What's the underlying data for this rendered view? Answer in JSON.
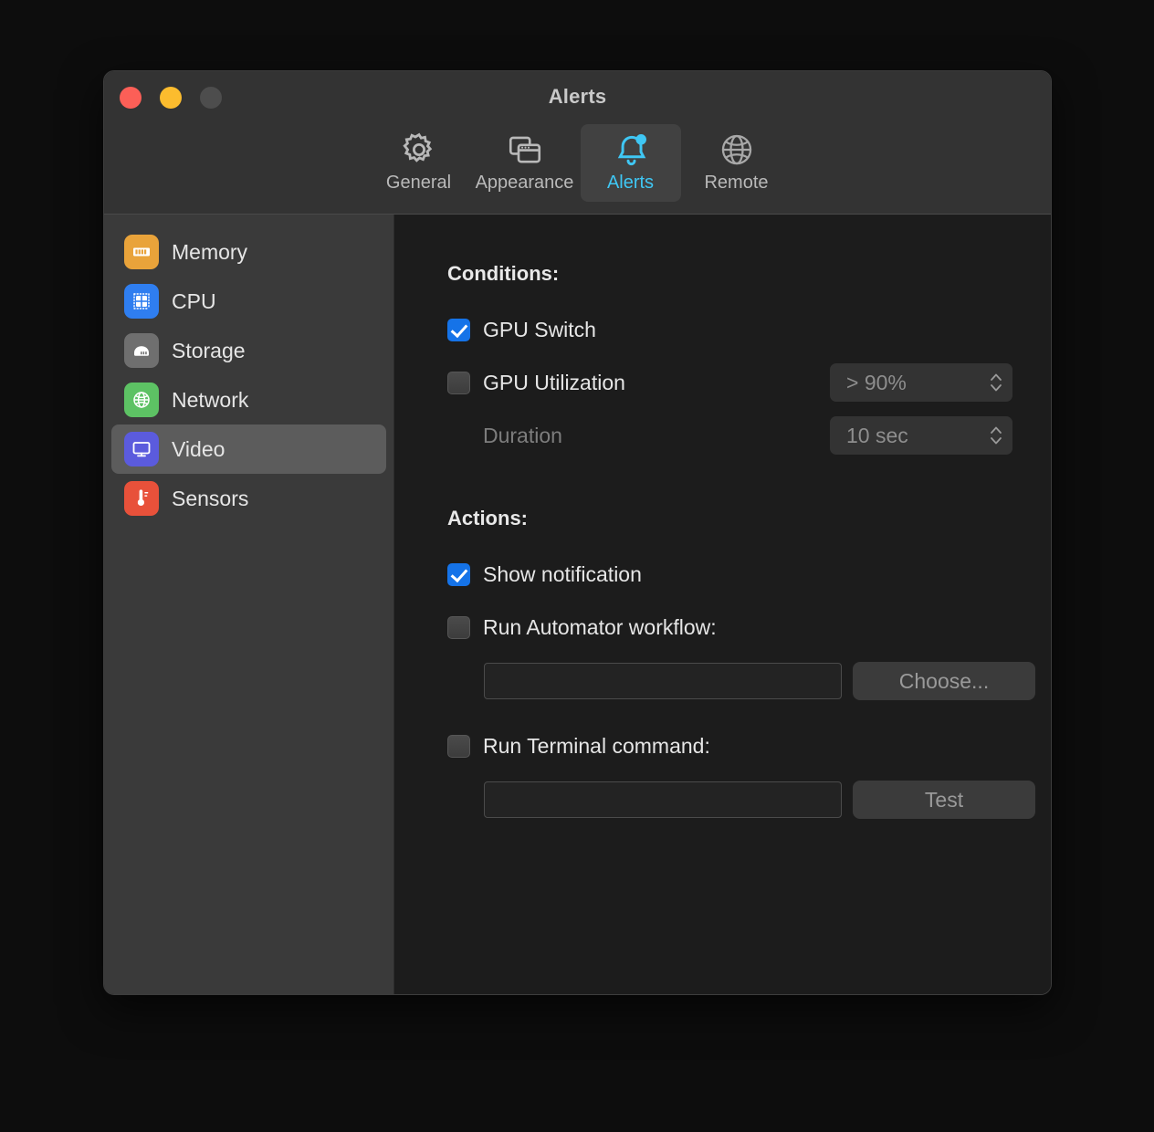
{
  "window": {
    "title": "Alerts",
    "traffic_lights": [
      {
        "name": "close",
        "color": "#fc5f57"
      },
      {
        "name": "minimize",
        "color": "#fcbc2e"
      },
      {
        "name": "zoom",
        "color": "#4d4d4d"
      }
    ]
  },
  "toolbar": {
    "active": "Alerts",
    "accent": "#3fc7f4",
    "items": [
      {
        "label": "General",
        "icon": "gear-icon"
      },
      {
        "label": "Appearance",
        "icon": "windows-icon"
      },
      {
        "label": "Alerts",
        "icon": "bell-icon"
      },
      {
        "label": "Remote",
        "icon": "globe-icon"
      }
    ]
  },
  "sidebar": {
    "selected": "Video",
    "items": [
      {
        "label": "Memory",
        "icon": "memory-icon",
        "color": "#e9a33a"
      },
      {
        "label": "CPU",
        "icon": "cpu-icon",
        "color": "#2f7ef0"
      },
      {
        "label": "Storage",
        "icon": "storage-icon",
        "color": "#6f6f6f"
      },
      {
        "label": "Network",
        "icon": "network-icon",
        "color": "#5dc264"
      },
      {
        "label": "Video",
        "icon": "display-icon",
        "color": "#5b5bdd"
      },
      {
        "label": "Sensors",
        "icon": "thermometer-icon",
        "color": "#e8513a"
      }
    ]
  },
  "conditions": {
    "heading": "Conditions:",
    "gpu_switch": {
      "label": "GPU Switch",
      "checked": true
    },
    "gpu_utilization": {
      "label": "GPU Utilization",
      "checked": false,
      "threshold": "> 90%"
    },
    "duration": {
      "label": "Duration",
      "value": "10 sec"
    }
  },
  "actions": {
    "heading": "Actions:",
    "show_notification": {
      "label": "Show notification",
      "checked": true
    },
    "automator": {
      "label": "Run Automator workflow:",
      "checked": false,
      "path_value": "",
      "path_placeholder": "",
      "button": "Choose..."
    },
    "terminal": {
      "label": "Run Terminal command:",
      "checked": false,
      "command_value": "",
      "command_placeholder": "",
      "button": "Test"
    }
  }
}
